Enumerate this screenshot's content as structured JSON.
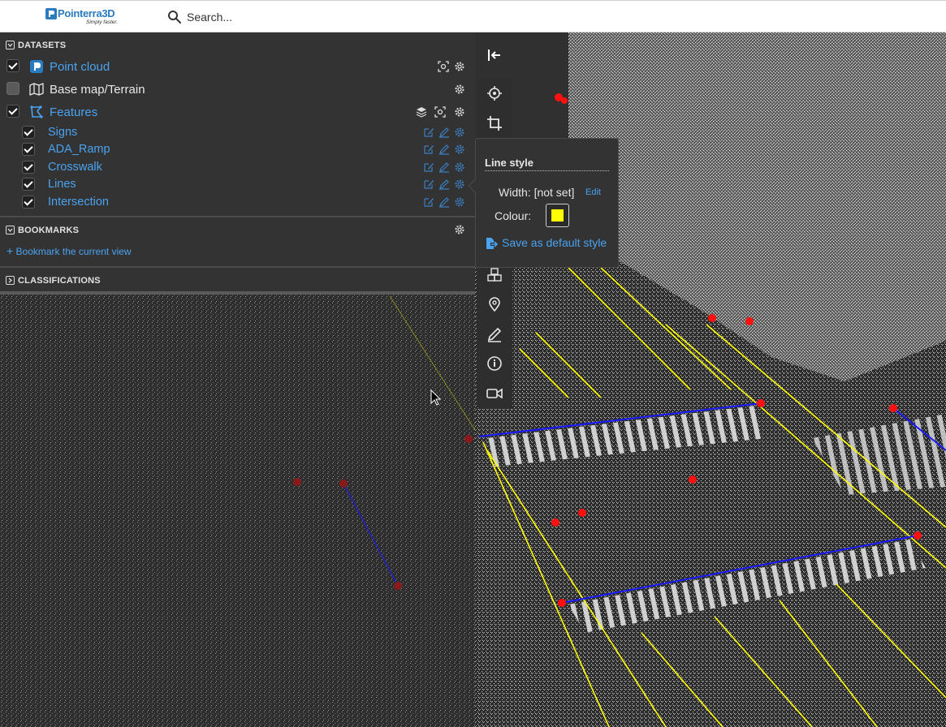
{
  "topbar": {
    "logo_text": "Pointerra",
    "logo_text_3d": "3D",
    "logo_tagline": "Simply faster.",
    "search_placeholder": "Search..."
  },
  "datasets": {
    "heading": "DATASETS",
    "items": [
      {
        "label": "Point cloud",
        "checked": true,
        "icon": "point-cloud-icon"
      },
      {
        "label": "Base map/Terrain",
        "checked": false,
        "icon": "map-icon"
      },
      {
        "label": "Features",
        "checked": true,
        "icon": "features-icon"
      }
    ],
    "features": [
      {
        "label": "Signs",
        "checked": true
      },
      {
        "label": "ADA_Ramp",
        "checked": true
      },
      {
        "label": "Crosswalk",
        "checked": true
      },
      {
        "label": "Lines",
        "checked": true
      },
      {
        "label": "Intersection",
        "checked": true
      }
    ]
  },
  "bookmarks": {
    "heading": "BOOKMARKS",
    "add_label": "Bookmark the current view"
  },
  "classifications": {
    "heading": "CLASSIFICATIONS"
  },
  "line_style": {
    "title": "Line style",
    "width_label": "Width: [not set]",
    "edit_label": "Edit",
    "colour_label": "Colour:",
    "colour": "#ffff00",
    "save_label": "Save as default style"
  },
  "colors": {
    "accent": "#4aa3f0",
    "panel_bg": "#333333",
    "feature_line": "#ffff00",
    "crosswalk_line": "#1a1aff",
    "marker": "#ff0000"
  }
}
